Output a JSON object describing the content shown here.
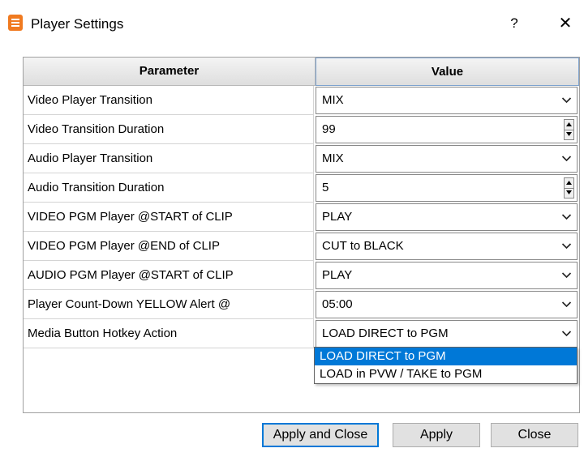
{
  "window": {
    "title": "Player Settings",
    "help": "?",
    "close": "✕"
  },
  "table": {
    "headers": {
      "parameter": "Parameter",
      "value": "Value"
    },
    "rows": [
      {
        "parameter": "Video Player Transition",
        "value": "MIX",
        "control": "dropdown"
      },
      {
        "parameter": "Video Transition Duration",
        "value": "99",
        "control": "spinner"
      },
      {
        "parameter": "Audio Player Transition",
        "value": "MIX",
        "control": "dropdown"
      },
      {
        "parameter": "Audio Transition Duration",
        "value": "5",
        "control": "spinner"
      },
      {
        "parameter": "VIDEO PGM Player @START of CLIP",
        "value": "PLAY",
        "control": "dropdown"
      },
      {
        "parameter": "VIDEO PGM Player @END of CLIP",
        "value": "CUT to BLACK",
        "control": "dropdown"
      },
      {
        "parameter": "AUDIO PGM Player @START of CLIP",
        "value": "PLAY",
        "control": "dropdown"
      },
      {
        "parameter": "Player Count-Down YELLOW Alert @",
        "value": "05:00",
        "control": "dropdown"
      },
      {
        "parameter": "Media Button Hotkey Action",
        "value": "LOAD DIRECT to PGM",
        "control": "dropdown"
      }
    ]
  },
  "dropdown_options": [
    "LOAD DIRECT to PGM",
    "LOAD in PVW / TAKE to PGM"
  ],
  "buttons": {
    "apply_close": "Apply and Close",
    "apply": "Apply",
    "close": "Close"
  },
  "colors": {
    "selection": "#0078d7",
    "app_icon": "#f07a20"
  }
}
